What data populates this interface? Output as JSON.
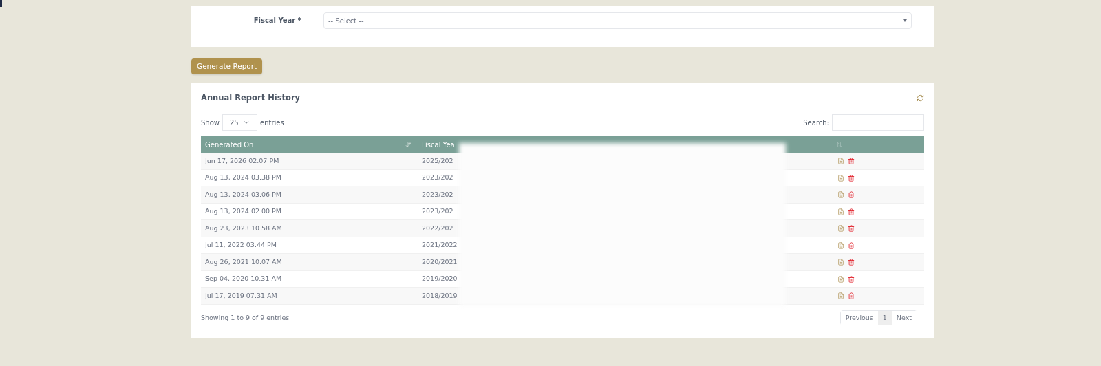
{
  "form": {
    "label": "Fiscal Year *",
    "select_placeholder": "-- Select --"
  },
  "generate_button": "Generate Report",
  "history": {
    "title": "Annual Report History",
    "length": {
      "before": "Show",
      "value": "25",
      "after": "entries"
    },
    "search_label": "Search:",
    "columns": [
      "Generated On",
      "Fiscal Yea"
    ],
    "rows": [
      {
        "generated_on": "Jun 17, 2026 02.07 PM",
        "fiscal_year": "2025/202"
      },
      {
        "generated_on": "Aug 13, 2024 03.38 PM",
        "fiscal_year": "2023/202"
      },
      {
        "generated_on": "Aug 13, 2024 03.06 PM",
        "fiscal_year": "2023/202"
      },
      {
        "generated_on": "Aug 13, 2024 02.00 PM",
        "fiscal_year": "2023/202"
      },
      {
        "generated_on": "Aug 23, 2023 10.58 AM",
        "fiscal_year": "2022/202"
      },
      {
        "generated_on": "Jul 11, 2022 03.44 PM",
        "fiscal_year": "2021/2022"
      },
      {
        "generated_on": "Aug 26, 2021 10.07 AM",
        "fiscal_year": "2020/2021"
      },
      {
        "generated_on": "Sep 04, 2020 10.31 AM",
        "fiscal_year": "2019/2020"
      },
      {
        "generated_on": "Jul 17, 2019 07.31 AM",
        "fiscal_year": "2018/2019"
      }
    ],
    "info": "Showing 1 to 9 of 9 entries",
    "pagination": [
      {
        "label": "Previous",
        "selected": false
      },
      {
        "label": "1",
        "selected": true
      },
      {
        "label": "Next",
        "selected": false
      }
    ]
  }
}
